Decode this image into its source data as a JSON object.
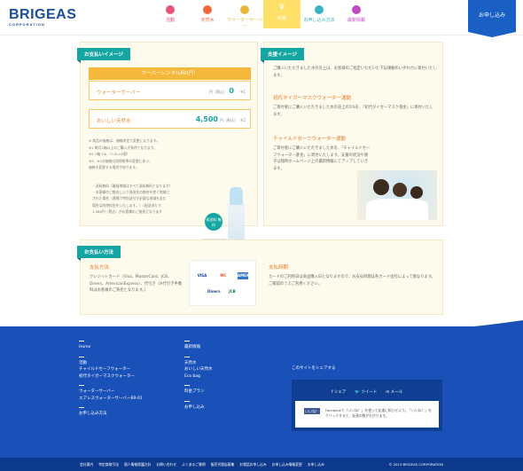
{
  "header": {
    "logo": "BRIGEAS",
    "logo_sub": "CORPORATION",
    "apply_label": "お申し込み",
    "nav": [
      {
        "label": "活動",
        "color": "#e8547a",
        "icon": "heart-icon"
      },
      {
        "label": "天然水",
        "color": "#ee6a3a",
        "icon": "drop-icon"
      },
      {
        "label": "ウォーターサーバー",
        "color": "#e8b83a",
        "icon": "server-icon"
      },
      {
        "label": "料金",
        "color": "#f0c040",
        "icon": "yen-icon",
        "active": true
      },
      {
        "label": "お申し込み方法",
        "color": "#3ab0c0",
        "icon": "envelope-icon"
      },
      {
        "label": "最新情報",
        "color": "#c04ac0",
        "icon": "info-icon"
      }
    ]
  },
  "payment_image": {
    "title": "お支払いイメージ",
    "rental": "サーバーレンタル料0円！",
    "server_label": "ウォーターサーバー",
    "server_value": "0",
    "server_unit": "円（税込）",
    "server_note": "※1",
    "water_label": "おいしい天然水",
    "water_value": "4,500",
    "water_unit": "円（税込）",
    "water_note": "※2",
    "notes": [
      "※ 商品の価格は、価格改定で変更になります。",
      "※1 毎月1箱以上のご購入が条件となります。",
      "※2 1箱 24L（7.2L×4個）",
      "※3、※1の価格は消費税率の変更に伴い、",
      "価格を変更する場合があります。"
    ],
    "notes2": [
      "・送料無料（離島地域はすべて送料無料となります）",
      "・お客様のご都合により発送先の都合を除く地域と",
      "された場合（遠隔で特別送付が必要な地域を含む",
      "場合は別途料金をいたします。）1配送あたり",
      "1,080円（税込）がお客様のご負担となります"
    ],
    "badge": "発送料\n無料"
  },
  "support_image": {
    "title": "支援イメージ",
    "intro": "ご購入いただきました水の売上は、お客様のご指定いただいた下記運動のいずれかに寄付いたします。",
    "s1_title": "初代タイガーマスクウォーター運動",
    "s1_text": "ご寄付者にご購入いただきました水の売上の5%を、「初代タイガーマスク基金」に寄付いたします。",
    "s2_title": "チャイルドセーフウォーター運動",
    "s2_text": "ご寄付者にご購入いただきました水を、「チャイルドセーフウォーター基金」に寄付いたします。支援の状況や親子は随時ホームページ上の最新情報にてアップしていきます。"
  },
  "payment_method": {
    "title": "お支払い方法",
    "left_head": "支払方法",
    "left_text": "クレジットカード（Visa、MasterCard、JCB、Diners、AmericanExpress）、代引き（※代引き手数料はお客様のご負担となります。）",
    "cards": [
      "VISA",
      "MC",
      "AMEX",
      "Diners",
      "JCB"
    ],
    "right_head": "支払時期",
    "right_text": "カードのご利用日は商品購入日となりますので、お支払時期は各カード会社によって異なります。ご確認のうえご利用ください。"
  },
  "footer": {
    "col1": [
      "Home",
      "",
      "活動",
      "チャイルドセーフウォーター",
      "初代タイガーマスクウォーター",
      "",
      "ウォーターサーバー",
      "エアレスウォーターサーバーBR-01",
      "",
      "お申し込み方法"
    ],
    "col2": [
      "最新情報",
      "",
      "天然水",
      "おいしい天然水",
      "Eco bag",
      "",
      "料金プラン",
      "",
      "お申し込み"
    ],
    "share_title": "このサイトをシェアする",
    "share_buttons": [
      "シェア",
      "ツイート",
      "メール"
    ],
    "fb_button": "いいね！",
    "fb_text": "Facebookで「いいね！」を使って友達に知らせよう。「いいね！」をクリックすると、友達の数がわかります。",
    "bottom_links": [
      "会社案内",
      "特定商取引法",
      "個人情報保護方針",
      "お問い合わせ",
      "よくあるご質問",
      "販売代理店募集",
      "お電話お申し込み",
      "お申し込み情報変更",
      "お申し込み"
    ],
    "copyright": "© 2013 BRIGEAS CORPORATION"
  }
}
